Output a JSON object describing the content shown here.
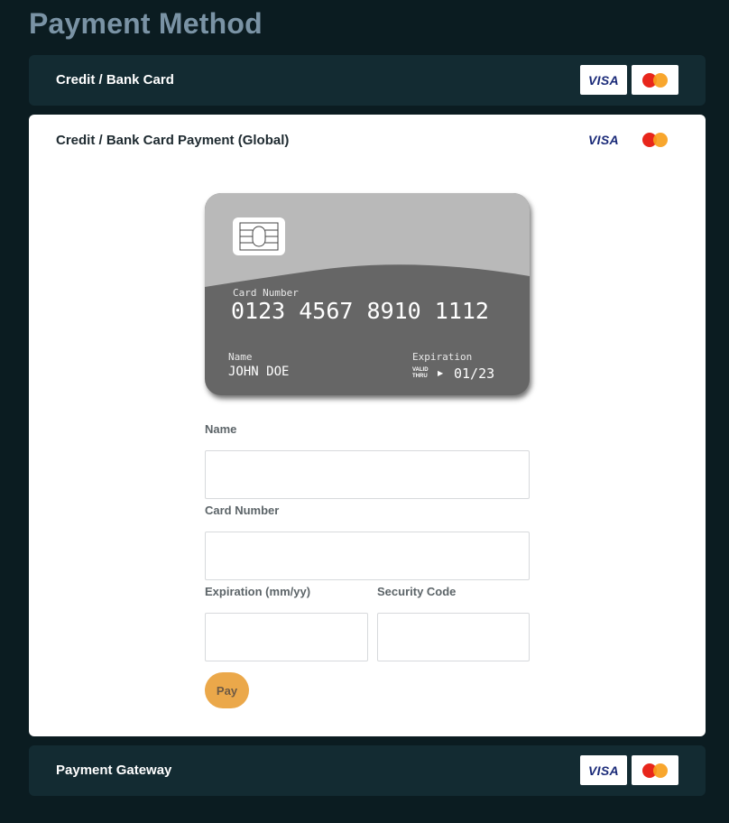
{
  "page": {
    "title": "Payment Method"
  },
  "methods": [
    {
      "label": "Credit / Bank Card",
      "logos": [
        "VISA",
        "mastercard-logo"
      ]
    },
    {
      "label": "Credit / Bank Card Payment (Global)",
      "logos": [
        "VISA",
        "mastercard-logo"
      ]
    },
    {
      "label": "Payment Gateway",
      "logos": [
        "VISA",
        "mastercard-logo"
      ]
    }
  ],
  "logos": {
    "visa": "VISA"
  },
  "card_preview": {
    "number_label": "Card Number",
    "number": "0123 4567 8910 1112",
    "name_label": "Name",
    "name": "JOHN DOE",
    "expiration_label": "Expiration",
    "valid_line1": "VALID",
    "valid_line2": "THRU",
    "expiration": "01/23",
    "arrow": "▶"
  },
  "form": {
    "name_label": "Name",
    "name_value": "",
    "card_number_label": "Card Number",
    "card_number_value": "",
    "expiration_label": "Expiration (mm/yy)",
    "expiration_value": "",
    "security_label": "Security Code",
    "security_value": "",
    "pay_label": "Pay"
  },
  "colors": {
    "background": "#0b1c21",
    "accordion": "#132b32",
    "title": "#7a93a5",
    "pay_button": "#eba84a",
    "card_dark": "#666666",
    "card_light": "#b9b9b9"
  }
}
